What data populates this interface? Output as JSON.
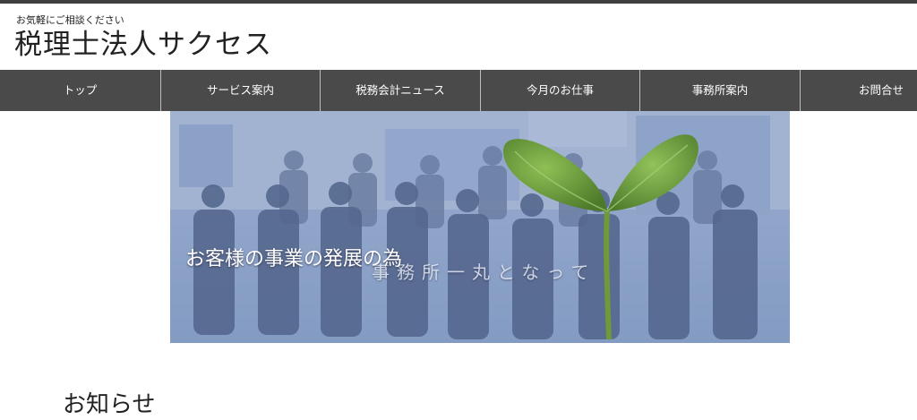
{
  "header": {
    "tagline": "お気軽にご相談ください",
    "title": "税理士法人サクセス"
  },
  "nav": {
    "items": [
      {
        "label": "トップ"
      },
      {
        "label": "サービス案内"
      },
      {
        "label": "税務会計ニュース"
      },
      {
        "label": "今月のお仕事"
      },
      {
        "label": "事務所案内"
      },
      {
        "label": "お問合せ"
      }
    ]
  },
  "hero": {
    "caption_main": "お客様の事業の発展の為",
    "caption_sub": "事務所一丸となって"
  },
  "news": {
    "heading": "お知らせ"
  },
  "colors": {
    "nav_bg": "#4a4a4a",
    "hero_tint": "#8ea5c9",
    "leaf_green": "#6f9a3a"
  }
}
